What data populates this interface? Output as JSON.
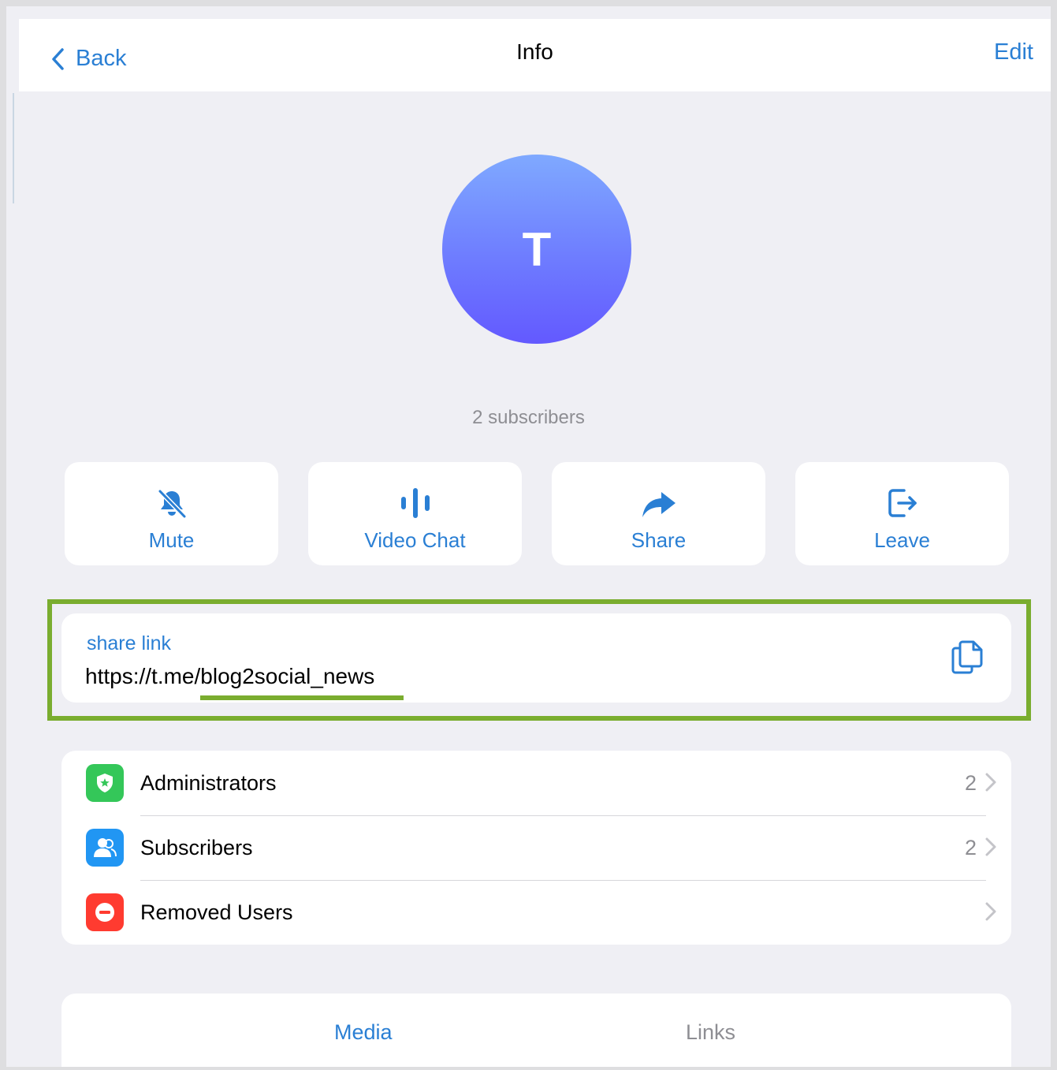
{
  "colors": {
    "accent": "#2a7fd4",
    "highlight": "#7aad2f",
    "admin_icon_bg": "#34c759",
    "subscribers_icon_bg": "#2196f3",
    "removed_icon_bg": "#ff3b30"
  },
  "navbar": {
    "back_label": "Back",
    "title": "Info",
    "edit_label": "Edit"
  },
  "profile": {
    "avatar_letter": "T",
    "subscribers_text": "2 subscribers"
  },
  "actions": [
    {
      "label": "Mute",
      "icon": "bell-slash-icon"
    },
    {
      "label": "Video Chat",
      "icon": "voice-bars-icon"
    },
    {
      "label": "Share",
      "icon": "share-arrow-icon"
    },
    {
      "label": "Leave",
      "icon": "leave-icon"
    }
  ],
  "share_link": {
    "label": "share link",
    "url": "https://t.me/blog2social_news",
    "copy_icon": "copy-icon"
  },
  "list": [
    {
      "label": "Administrators",
      "count": "2",
      "icon": "shield-star-icon"
    },
    {
      "label": "Subscribers",
      "count": "2",
      "icon": "person-icon"
    },
    {
      "label": "Removed Users",
      "count": "",
      "icon": "minus-circle-icon"
    }
  ],
  "tabs": [
    {
      "label": "Media",
      "selected": true
    },
    {
      "label": "Links",
      "selected": false
    }
  ]
}
